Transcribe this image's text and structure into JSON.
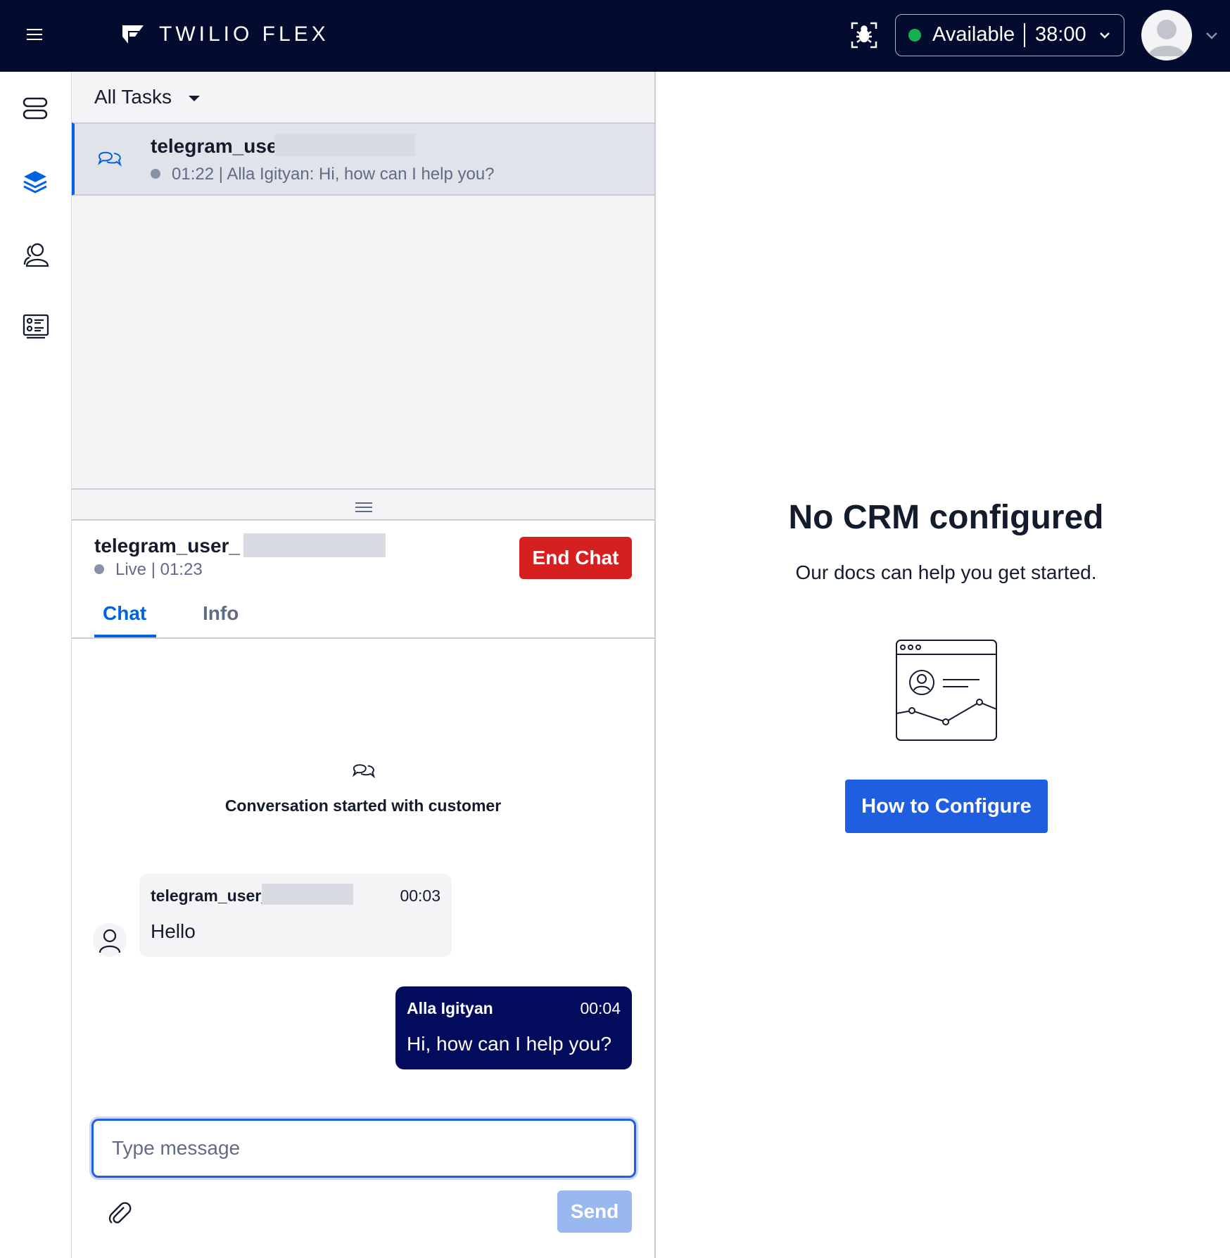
{
  "header": {
    "brand": "TWILIO FLEX",
    "status": "Available",
    "timer": "38:00",
    "icons": [
      "menu-icon",
      "flex-logo-icon",
      "debug-icon",
      "chevron-down-icon",
      "avatar-icon"
    ]
  },
  "sidebar": {
    "items": [
      {
        "name": "agent-desktop",
        "icon": "server-icon"
      },
      {
        "name": "teams",
        "icon": "layers-icon"
      },
      {
        "name": "contacts",
        "icon": "users-icon"
      },
      {
        "name": "queues-stats",
        "icon": "list-icon"
      }
    ]
  },
  "tasklist": {
    "filter_label": "All Tasks",
    "tasks": [
      {
        "name": "telegram_user_",
        "elapsed": "01:22",
        "preview": "Alla Igityan: Hi, how can I help you?"
      }
    ]
  },
  "chat": {
    "customer_name": "telegram_user_",
    "status": "Live",
    "elapsed": "01:23",
    "end_chat_label": "End Chat",
    "tabs": [
      {
        "label": "Chat",
        "active": true
      },
      {
        "label": "Info",
        "active": false
      }
    ],
    "conversation_started": "Conversation started with customer",
    "messages": [
      {
        "author": "telegram_user_",
        "time": "00:03",
        "body": "Hello",
        "direction": "inbound"
      },
      {
        "author": "Alla Igityan",
        "time": "00:04",
        "body": "Hi, how can I help you?",
        "direction": "outbound"
      }
    ],
    "input_placeholder": "Type message",
    "send_label": "Send"
  },
  "crm": {
    "title": "No CRM configured",
    "subtitle": "Our docs can help you get started.",
    "button_label": "How to Configure"
  },
  "colors": {
    "topbar": "#030b2e",
    "accent": "#0263e0",
    "end_chat": "#d61f1f",
    "agent_bubble": "#030b5d",
    "status_available": "#14b053"
  }
}
